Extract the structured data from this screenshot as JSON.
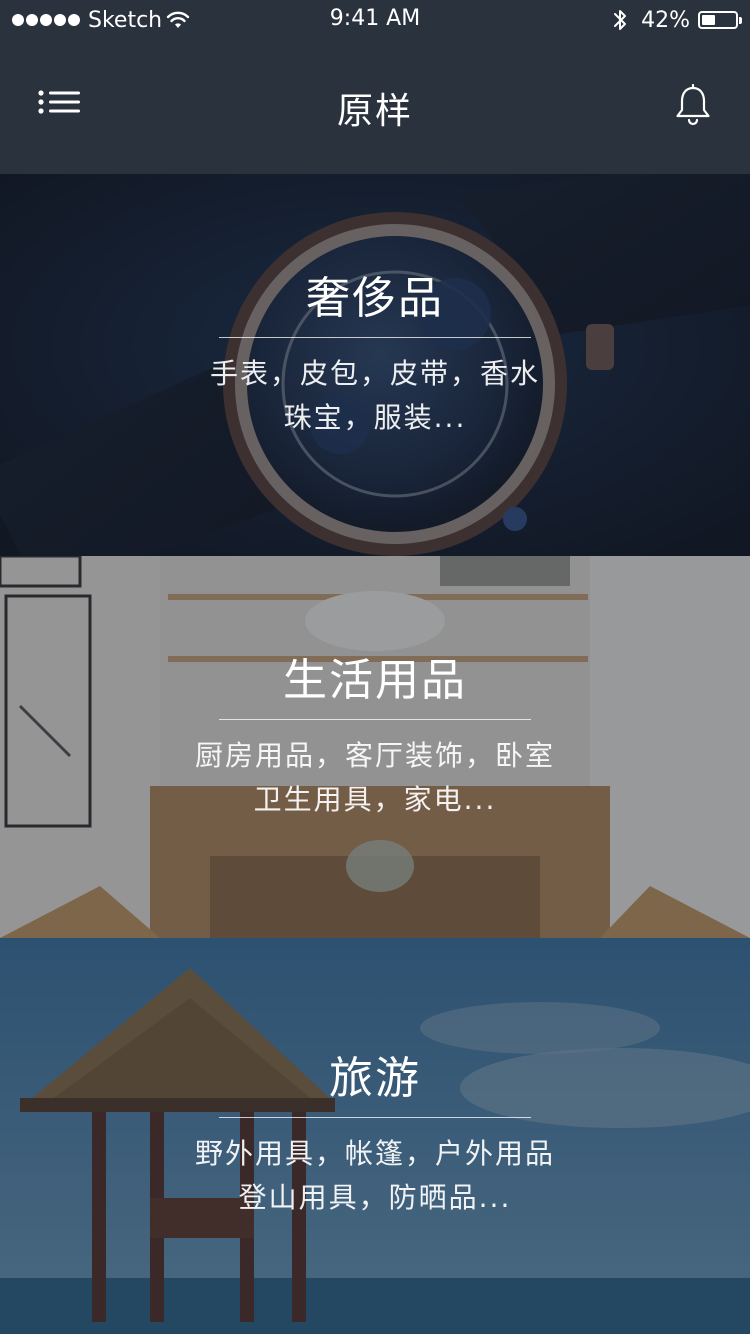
{
  "status_bar": {
    "carrier": "Sketch",
    "time": "9:41 AM",
    "battery_percent": "42%",
    "battery_level": 0.42,
    "signal_bars": 5
  },
  "nav": {
    "title": "原样",
    "menu_icon": "menu-list-icon",
    "notification_icon": "bell-icon"
  },
  "categories": [
    {
      "title": "奢侈品",
      "line1": "手表，皮包，皮带，香水",
      "line2": "珠宝，服装...",
      "image": "luxury-watch-photo"
    },
    {
      "title": "生活用品",
      "line1": "厨房用品，客厅装饰，卧室",
      "line2": "卫生用具，家电...",
      "image": "kitchen-interior-photo"
    },
    {
      "title": "旅游",
      "line1": "野外用具，帐篷，户外用品",
      "line2": "登山用具，防晒品...",
      "image": "beach-hut-photo"
    }
  ],
  "colors": {
    "nav_background": "#2a323d",
    "text": "#ffffff"
  }
}
